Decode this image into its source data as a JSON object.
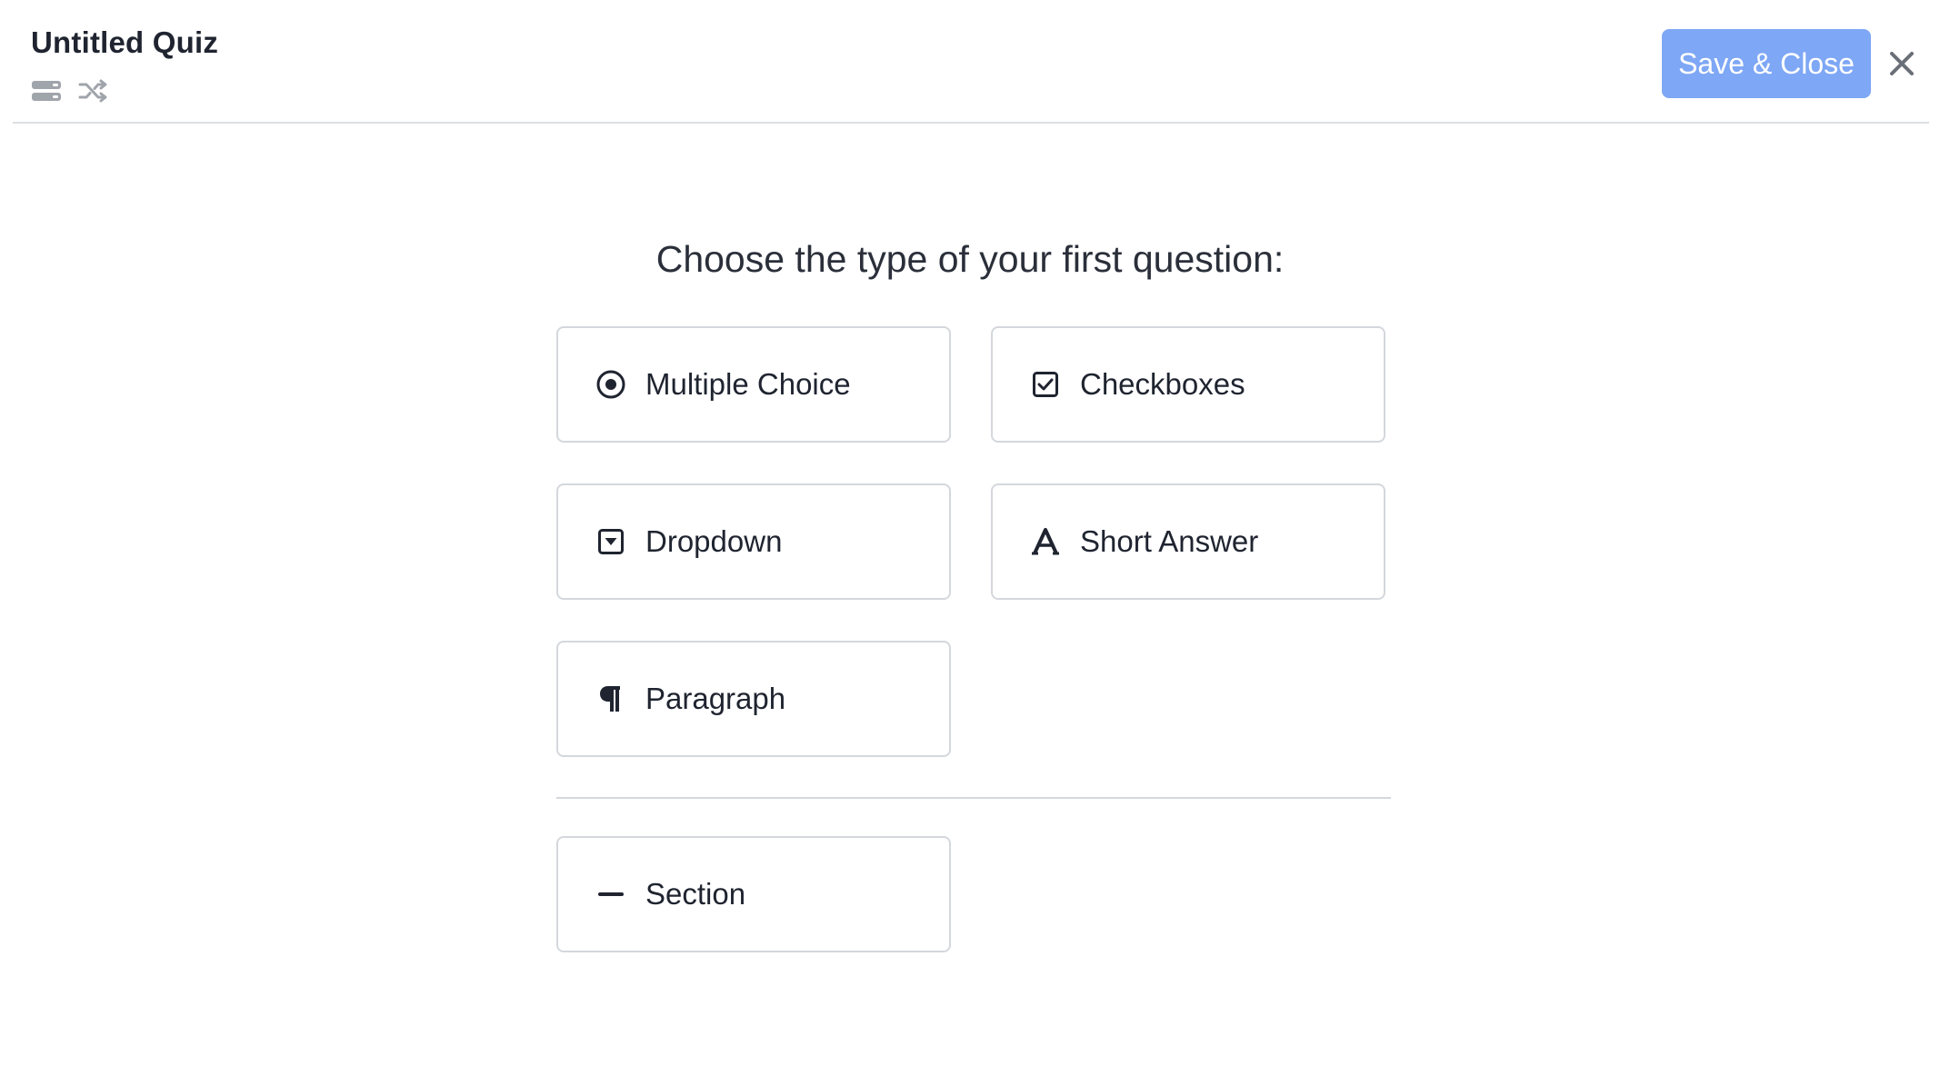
{
  "header": {
    "title": "Untitled Quiz",
    "save_label": "Save & Close",
    "icons": [
      "sections-icon",
      "shuffle-icon"
    ],
    "close_icon": "close-icon"
  },
  "main": {
    "prompt": "Choose the type of your first question:",
    "question_types": [
      {
        "label": "Multiple Choice",
        "icon": "radio-icon"
      },
      {
        "label": "Checkboxes",
        "icon": "checkbox-icon"
      },
      {
        "label": "Dropdown",
        "icon": "dropdown-icon"
      },
      {
        "label": "Short Answer",
        "icon": "text-a-icon"
      },
      {
        "label": "Paragraph",
        "icon": "pilcrow-icon"
      }
    ],
    "section": {
      "label": "Section",
      "icon": "minus-icon"
    }
  },
  "colors": {
    "accent": "#7ea7f5",
    "text": "#1f2430",
    "border": "#d4d7dc",
    "icon_gray": "#a0a4ab"
  }
}
